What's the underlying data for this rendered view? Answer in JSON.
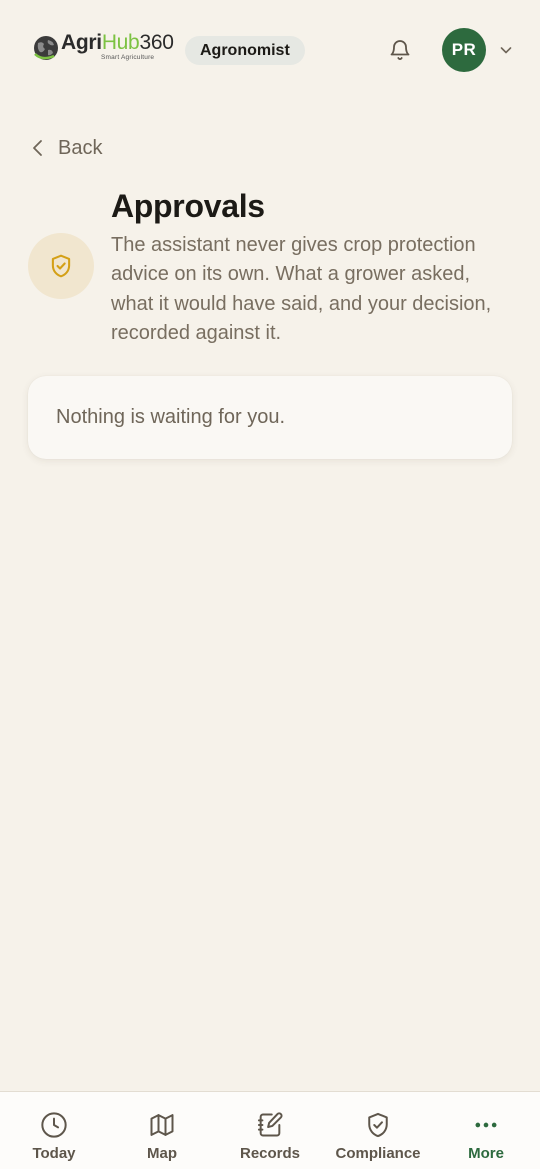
{
  "header": {
    "logo": {
      "brand_a": "Agri",
      "brand_b": "Hub",
      "brand_c": "360",
      "tagline": "Smart Agriculture"
    },
    "role_badge": "Agronomist",
    "avatar_initials": "PR"
  },
  "back_label": "Back",
  "section": {
    "title": "Approvals",
    "description": "The assistant never gives crop protection advice on its own. What a grower asked, what it would have said, and your decision, recorded against it.",
    "icon": "shield-check-icon"
  },
  "empty_state": "Nothing is waiting for you.",
  "bottom_nav": [
    {
      "label": "Today",
      "icon": "clock-icon",
      "active": false
    },
    {
      "label": "Map",
      "icon": "map-icon",
      "active": false
    },
    {
      "label": "Records",
      "icon": "notebook-pen-icon",
      "active": false
    },
    {
      "label": "Compliance",
      "icon": "shield-check-icon",
      "active": false
    },
    {
      "label": "More",
      "icon": "more-dots-icon",
      "active": true
    }
  ],
  "colors": {
    "background": "#f6f2ea",
    "primary_green": "#2d6a3e",
    "accent_gold": "#d4a017",
    "muted_text": "#786e60"
  }
}
